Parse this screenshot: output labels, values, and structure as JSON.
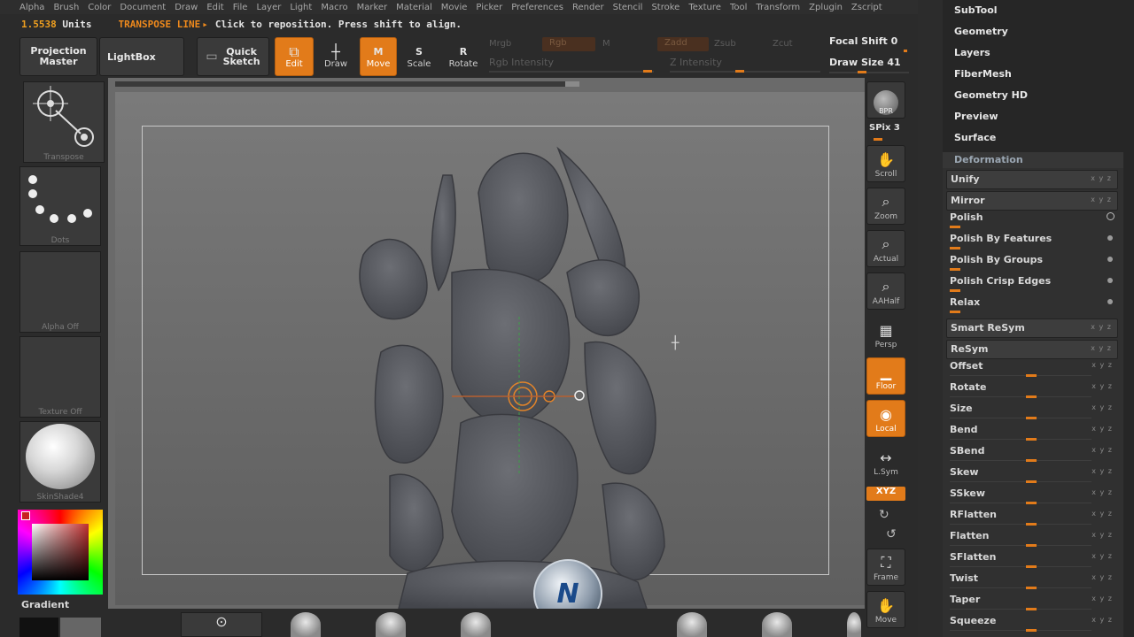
{
  "menu": [
    "Alpha",
    "Brush",
    "Color",
    "Document",
    "Draw",
    "Edit",
    "File",
    "Layer",
    "Light",
    "Macro",
    "Marker",
    "Material",
    "Movie",
    "Picker",
    "Preferences",
    "Render",
    "Stencil",
    "Stroke",
    "Texture",
    "Tool",
    "Transform",
    "Zplugin",
    "Zscript"
  ],
  "status": {
    "units_value": "1.5538",
    "units_label": "Units",
    "action": "TRANSPOSE LINE",
    "hint": "Click to reposition. Press shift to align."
  },
  "toolbar": {
    "projection_master": "Projection Master",
    "lightbox": "LightBox",
    "quick_sketch": "Quick Sketch",
    "edit": "Edit",
    "draw": "Draw",
    "move": "Move",
    "scale": "Scale",
    "rotate": "Rotate",
    "mrgb": "Mrgb",
    "rgb": "Rgb",
    "m": "M",
    "zadd": "Zadd",
    "zsub": "Zsub",
    "zcut": "Zcut",
    "rgb_intensity": "Rgb Intensity",
    "z_intensity": "Z Intensity",
    "focal_shift_label": "Focal Shift",
    "focal_shift_value": "0",
    "draw_size_label": "Draw Size",
    "draw_size_value": "41",
    "move_key": "M",
    "scale_key": "S",
    "rotate_key": "R"
  },
  "left": {
    "transpose": "Transpose",
    "dots": "Dots",
    "alpha": "Alpha Off",
    "texture": "Texture Off",
    "material": "SkinShade4",
    "gradient": "Gradient"
  },
  "rightshelf": {
    "bpr": "BPR",
    "spix": "SPix 3",
    "scroll": "Scroll",
    "zoom": "Zoom",
    "actual": "Actual",
    "aahalf": "AAHalf",
    "persp": "Persp",
    "floor": "Floor",
    "local": "Local",
    "lsym": "L.Sym",
    "xyz": "XYZ",
    "frame": "Frame",
    "move": "Move"
  },
  "palette": {
    "menus": [
      "SubTool",
      "Geometry",
      "Layers",
      "FiberMesh",
      "Geometry HD",
      "Preview",
      "Surface"
    ],
    "deformation_title": "Deformation",
    "buttons": [
      "Unify",
      "Mirror",
      "Smart ReSym",
      "ReSym"
    ],
    "polish": [
      "Polish",
      "Polish By Features",
      "Polish By Groups",
      "Polish Crisp Edges",
      "Relax"
    ],
    "sliders": [
      "Offset",
      "Rotate",
      "Size",
      "Bend",
      "SBend",
      "Skew",
      "SSkew",
      "RFlatten",
      "Flatten",
      "SFlatten",
      "Twist",
      "Taper",
      "Squeeze"
    ],
    "axis_marks": "x y z"
  },
  "colors": {
    "accent": "#e27b1a",
    "panel": "#2b2b2b",
    "canvas": "#6a6a6a"
  }
}
